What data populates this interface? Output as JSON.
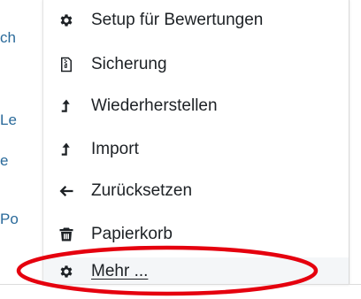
{
  "background_fragments": [
    "ch",
    "Le",
    "e",
    "Po"
  ],
  "menu": {
    "items": [
      {
        "label": "Setup für Bewertungen",
        "icon": "gear-icon"
      },
      {
        "label": "Sicherung",
        "icon": "file-archive-icon"
      },
      {
        "label": "Wiederherstellen",
        "icon": "level-up-icon"
      },
      {
        "label": "Import",
        "icon": "level-up-icon"
      },
      {
        "label": "Zurücksetzen",
        "icon": "arrow-left-icon"
      },
      {
        "label": "Papierkorb",
        "icon": "trash-icon"
      },
      {
        "label": "Mehr ...",
        "icon": "gear-icon"
      }
    ]
  },
  "colors": {
    "text": "#1d2125",
    "highlight_ring": "#e5000e",
    "background_link": "#2a6a9a",
    "hover_row": "#f4f6f8"
  }
}
